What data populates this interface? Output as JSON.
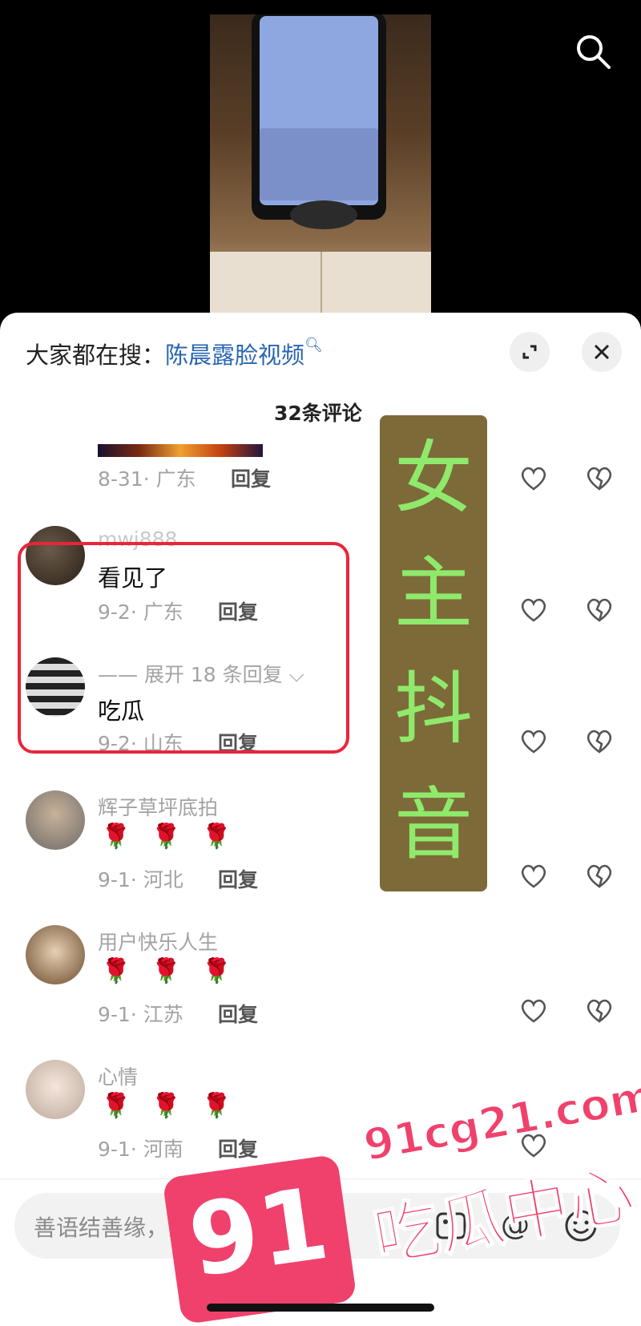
{
  "search": {
    "prefix": "大家都在搜：",
    "keyword": "陈晨露脸视频",
    "icon": "search-icon"
  },
  "comments_count": "32条评论",
  "comments": [
    {
      "meta": "8-31· 广东",
      "reply": "回复"
    },
    {
      "user": "mwj888",
      "text": "看见了",
      "meta": "9-2· 广东",
      "reply": "回复"
    },
    {
      "expand": "—— 展开 18 条回复 ⌵",
      "text": "吃瓜",
      "meta": "9-2· 山东",
      "reply": "回复"
    },
    {
      "user": "辉子草坪底拍",
      "text": "🌹 🌹 🌹",
      "meta": "9-1· 河北",
      "reply": "回复"
    },
    {
      "user": "用户快乐人生",
      "text": "🌹 🌹 🌹",
      "meta": "9-1· 江苏",
      "reply": "回复"
    },
    {
      "user": "心情",
      "text": "🌹 🌹 🌹",
      "meta": "9-1· 河南",
      "reply": "回复"
    }
  ],
  "banner": {
    "chars": [
      "女",
      "主",
      "抖",
      "音"
    ]
  },
  "input": {
    "placeholder": "善语结善缘，恶言伤人心"
  },
  "watermark": {
    "badge": "91",
    "url": "91cg21.com",
    "text": "吃瓜中心"
  },
  "colors": {
    "keyword": "#2a66b0",
    "highlight_border": "#e8263a",
    "banner_bg": "#7d6a39",
    "banner_text": "#8fea6c",
    "watermark": "#f0416c"
  }
}
